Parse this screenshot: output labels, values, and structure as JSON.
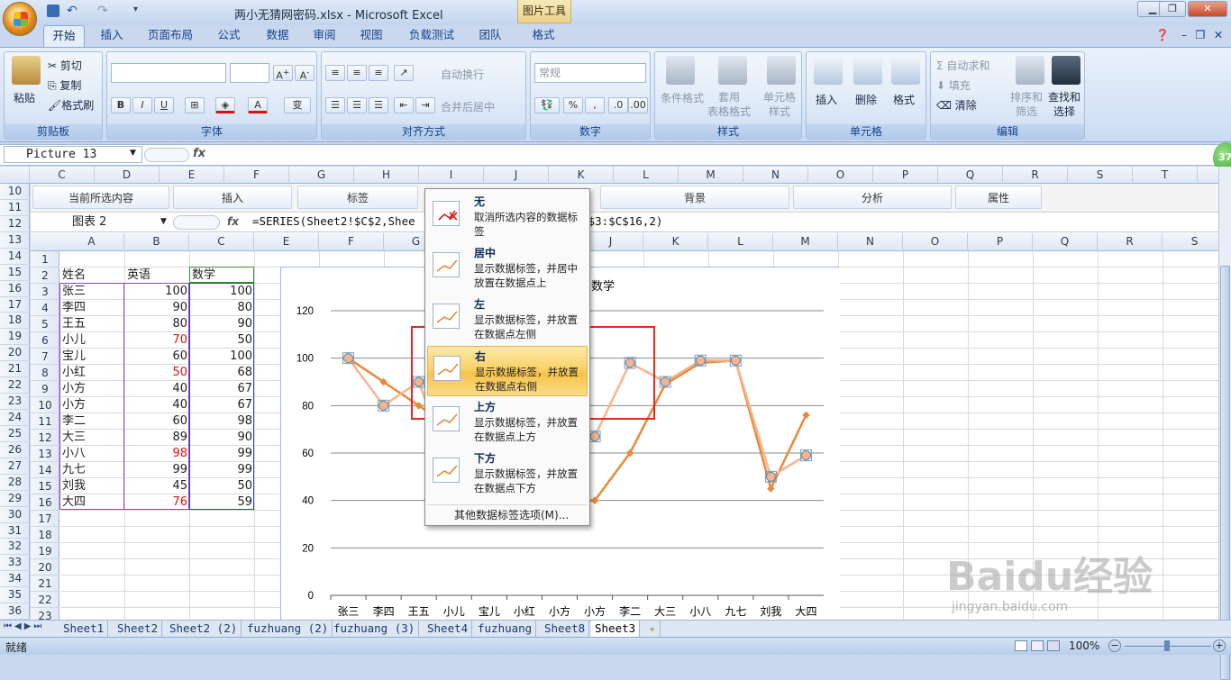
{
  "window": {
    "title": "两小无猜网密码.xlsx - Microsoft Excel",
    "context_tab": "图片工具"
  },
  "ribbon_tabs": [
    "开始",
    "插入",
    "页面布局",
    "公式",
    "数据",
    "审阅",
    "视图",
    "负载测试",
    "团队",
    "格式"
  ],
  "ribbon": {
    "clipboard": {
      "paste": "粘贴",
      "cut": "剪切",
      "copy": "复制",
      "format_painter": "格式刷",
      "label": "剪贴板"
    },
    "font": {
      "label": "字体"
    },
    "alignment": {
      "wrap": "自动换行",
      "merge": "合并后居中",
      "label": "对齐方式"
    },
    "number": {
      "format": "常规",
      "label": "数字"
    },
    "styles": {
      "conditional": "条件格式",
      "table": "套用\n表格格式",
      "cell": "单元格\n样式",
      "label": "样式"
    },
    "cells": {
      "insert": "插入",
      "delete": "删除",
      "format": "格式",
      "label": "单元格"
    },
    "editing": {
      "autosum": "自动求和",
      "fill": "填充",
      "clear": "清除",
      "sort": "排序和\n筛选",
      "find": "查找和\n选择",
      "label": "编辑"
    }
  },
  "name_box": "Picture 13",
  "fx": "fx",
  "status_badge": "37",
  "outer_columns": [
    "C",
    "D",
    "E",
    "F",
    "G",
    "H",
    "I",
    "J",
    "K",
    "L",
    "M",
    "N",
    "O",
    "P",
    "Q",
    "R",
    "S",
    "T"
  ],
  "outer_rows": [
    "10",
    "11",
    "12",
    "13",
    "14",
    "15",
    "16",
    "17",
    "18",
    "19",
    "20",
    "21",
    "22",
    "23",
    "24",
    "25",
    "26",
    "27",
    "28",
    "29",
    "30",
    "31",
    "32",
    "33",
    "34",
    "35",
    "36"
  ],
  "inner": {
    "toolbar": [
      "当前所选内容",
      "插入",
      "标签",
      "背景",
      "分析",
      "属性"
    ],
    "name_box": "图表 2",
    "formula": "=SERIES(Sheet2!$C$2,Shee",
    "formula_tail": "$3:$C$16,2)",
    "columns": [
      "A",
      "B",
      "C",
      "E",
      "F",
      "G",
      "H",
      "I",
      "J",
      "K",
      "L",
      "M",
      "N",
      "O",
      "P",
      "Q",
      "R",
      "S"
    ],
    "rows": [
      "1",
      "2",
      "3",
      "4",
      "5",
      "6",
      "7",
      "8",
      "9",
      "10",
      "11",
      "12",
      "13",
      "14",
      "15",
      "16",
      "17",
      "18",
      "19",
      "20",
      "21",
      "22",
      "23"
    ],
    "header": {
      "name": "姓名",
      "english": "英语",
      "math": "数学"
    },
    "table": [
      {
        "name": "张三",
        "english": 100,
        "math": 100
      },
      {
        "name": "李四",
        "english": 90,
        "math": 80
      },
      {
        "name": "王五",
        "english": 80,
        "math": 90
      },
      {
        "name": "小儿",
        "english": 70,
        "math": 50
      },
      {
        "name": "宝儿",
        "english": 60,
        "math": 100
      },
      {
        "name": "小红",
        "english": 50,
        "math": 68
      },
      {
        "name": "小方",
        "english": 40,
        "math": 67
      },
      {
        "name": "小方",
        "english": 40,
        "math": 67
      },
      {
        "name": "李二",
        "english": 60,
        "math": 98
      },
      {
        "name": "大三",
        "english": 89,
        "math": 90
      },
      {
        "name": "小八",
        "english": 98,
        "math": 99
      },
      {
        "name": "九七",
        "english": 99,
        "math": 99
      },
      {
        "name": "刘我",
        "english": 45,
        "math": 50
      },
      {
        "name": "大四",
        "english": 76,
        "math": 59
      }
    ],
    "red_english_rows": [
      3,
      5,
      10,
      13
    ]
  },
  "chart_data": {
    "type": "line",
    "title": "数学",
    "categories": [
      "张三",
      "李四",
      "王五",
      "小儿",
      "宝儿",
      "小红",
      "小方",
      "小方",
      "李二",
      "大三",
      "小八",
      "九七",
      "刘我",
      "大四"
    ],
    "series": [
      {
        "values": [
          100,
          90,
          80,
          70,
          60,
          50,
          40,
          40,
          60,
          89,
          98,
          99,
          45,
          76
        ],
        "color": "#e8893c"
      },
      {
        "values": [
          100,
          80,
          90,
          50,
          100,
          68,
          67,
          67,
          98,
          90,
          99,
          99,
          50,
          59
        ],
        "color": "#f7b48c"
      }
    ],
    "yticks": [
      "0",
      "20",
      "40",
      "60",
      "80",
      "100",
      "120"
    ],
    "ylim": [
      0,
      120
    ],
    "grid": true
  },
  "label_menu": {
    "items": [
      {
        "title": "无",
        "desc": "取消所选内容的数据标签"
      },
      {
        "title": "居中",
        "desc": "显示数据标签，并居中放置在数据点上"
      },
      {
        "title": "左",
        "desc": "显示数据标签，并放置在数据点左侧"
      },
      {
        "title": "右",
        "desc": "显示数据标签，并放置在数据点右侧"
      },
      {
        "title": "上方",
        "desc": "显示数据标签，并放置在数据点上方"
      },
      {
        "title": "下方",
        "desc": "显示数据标签，并放置在数据点下方"
      }
    ],
    "more": "其他数据标签选项(M)..."
  },
  "sheet_tabs": [
    "Sheet1",
    "Sheet2",
    "Sheet2 (2)",
    "fuzhuang (2)",
    "fuzhuang (3)",
    "Sheet4",
    "fuzhuang",
    "Sheet8",
    "Sheet3"
  ],
  "status": {
    "ready": "就绪",
    "zoom": "100%"
  },
  "watermark": {
    "brand": "Baidu经验",
    "url": "jingyan.baidu.com"
  }
}
